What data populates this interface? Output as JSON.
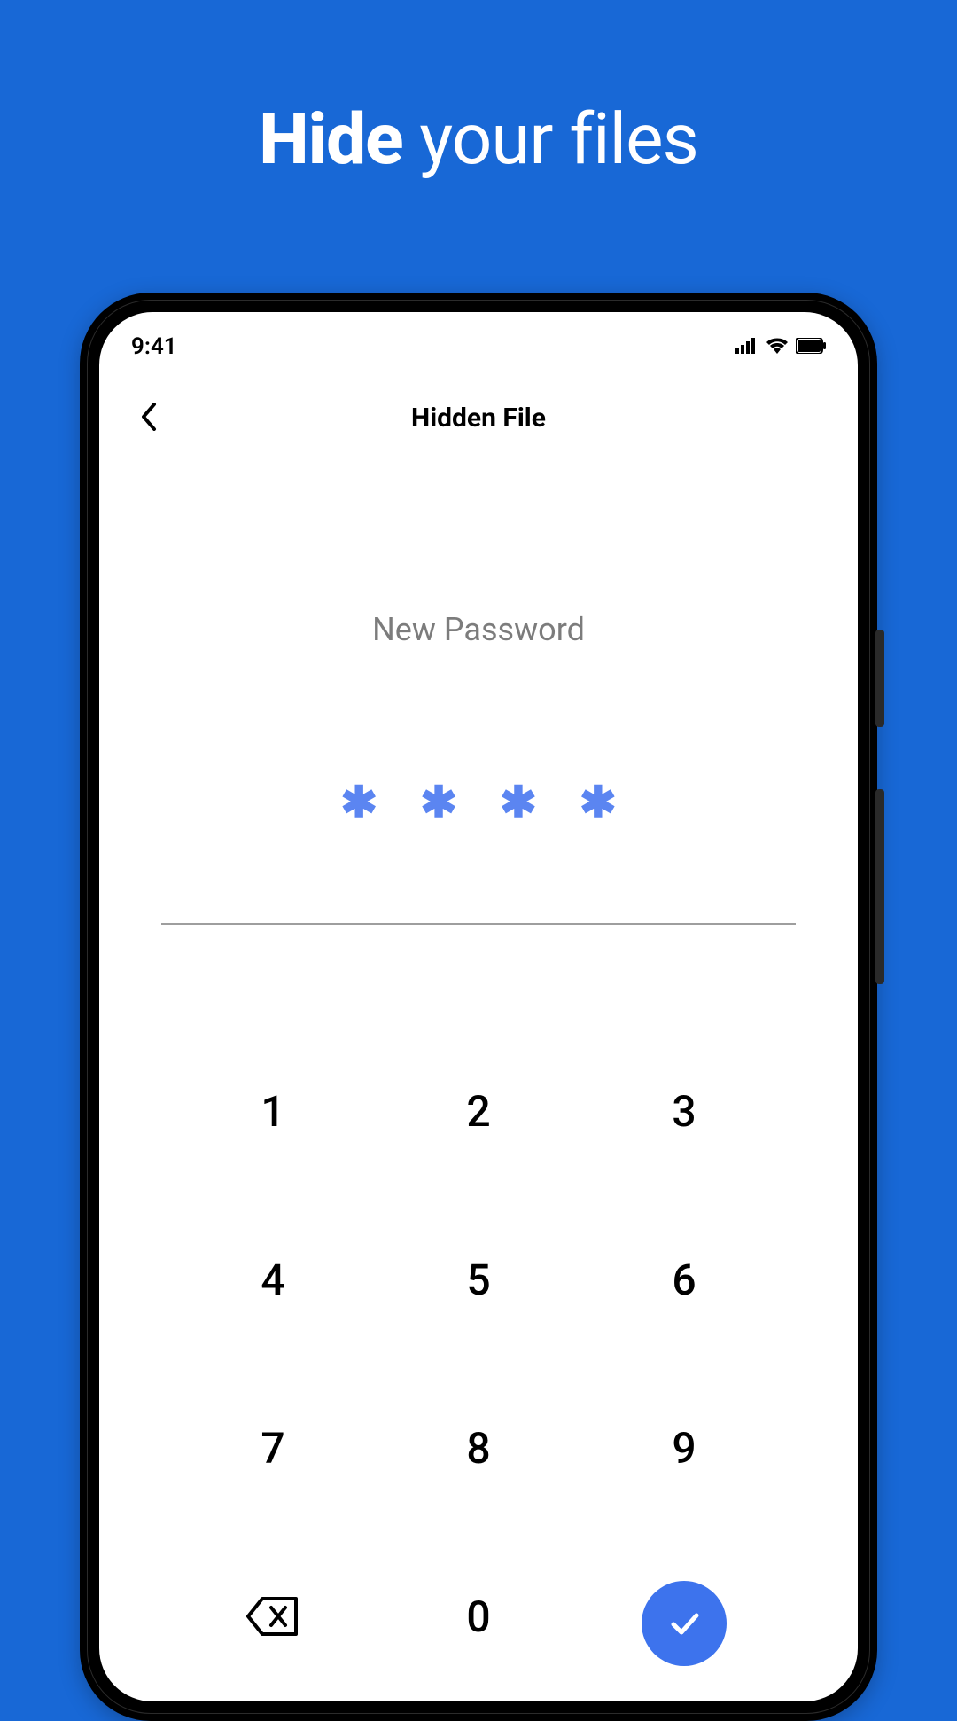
{
  "headline": {
    "bold": "Hide",
    "light": " your files"
  },
  "status": {
    "time": "9:41"
  },
  "nav": {
    "title": "Hidden File"
  },
  "password": {
    "prompt": "New Password",
    "mask": "✱",
    "length": 4
  },
  "keypad": {
    "k1": "1",
    "k2": "2",
    "k3": "3",
    "k4": "4",
    "k5": "5",
    "k6": "6",
    "k7": "7",
    "k8": "8",
    "k9": "9",
    "k0": "0"
  },
  "colors": {
    "accent": "#3d73ed",
    "bg": "#1868d6"
  }
}
